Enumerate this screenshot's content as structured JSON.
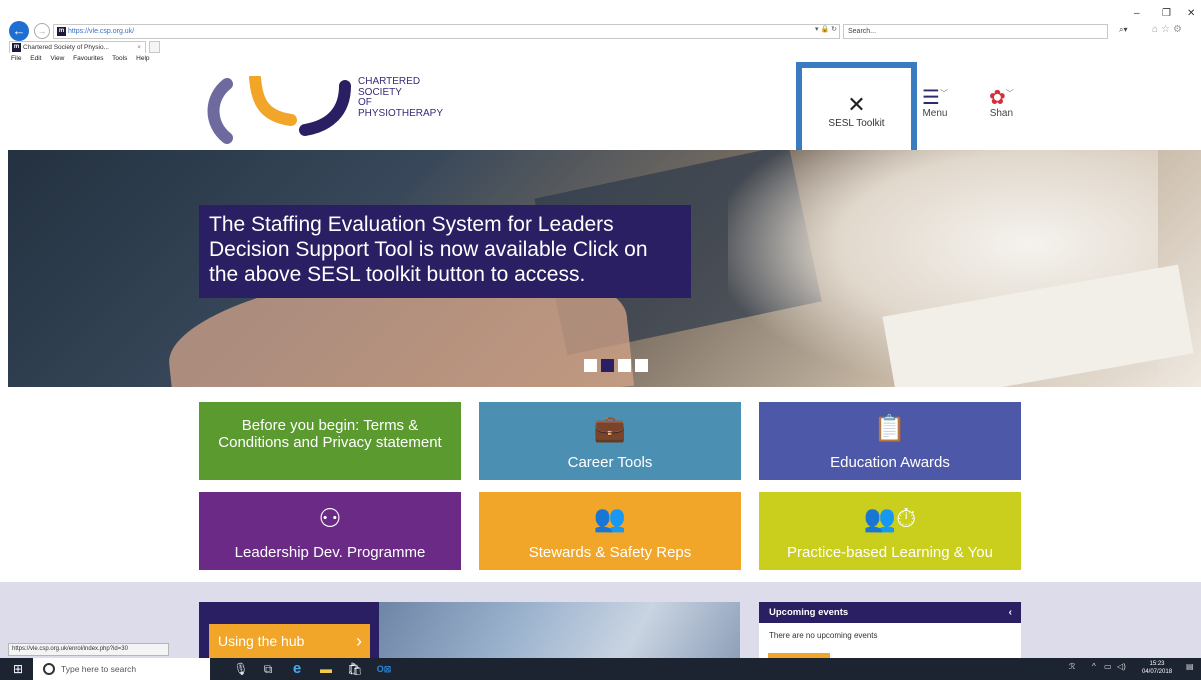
{
  "browser": {
    "address": "https://vle.csp.org.uk/",
    "search_placeholder": "Search...",
    "tab_title": "Chartered Society of Physio...",
    "tab_close": "×",
    "menu": [
      "File",
      "Edit",
      "View",
      "Favourites",
      "Tools",
      "Help"
    ],
    "status_url": "https://vle.csp.org.uk/enrol/index.php?id=30"
  },
  "site": {
    "org_name_lines": [
      "CHARTERED",
      "SOCIETY",
      "OF",
      "PHYSIOTHERAPY"
    ],
    "header": {
      "sesl_label": "SESL Toolkit",
      "menu_label": "Menu",
      "user_label": "Shan"
    },
    "hero": {
      "caption": "The Staffing Evaluation System for Leaders Decision Support Tool is now available Click on the above SESL toolkit button to access.",
      "slides": 4,
      "active_slide": 2
    },
    "tiles": [
      {
        "label": "Before you begin: Terms & Conditions and Privacy statement",
        "color": "#5b9a2f",
        "icon": ""
      },
      {
        "label": "Career Tools",
        "color": "#4b8fb3",
        "icon": "briefcase-icon"
      },
      {
        "label": "Education Awards",
        "color": "#4d59a8",
        "icon": "clipboard-icon"
      },
      {
        "label": "Leadership Dev. Programme",
        "color": "#6b2a86",
        "icon": "org-chart-icon"
      },
      {
        "label": "Stewards & Safety Reps",
        "color": "#f1a62a",
        "icon": "people-icon"
      },
      {
        "label": "Practice-based Learning & You",
        "color": "#c9cf1c",
        "icon": "clock-people-icon"
      }
    ],
    "hub_button": "Using the hub",
    "events": {
      "title": "Upcoming events",
      "empty_text": "There are no upcoming events"
    }
  },
  "taskbar": {
    "search_placeholder": "Type here to search",
    "time": "15:23",
    "date": "04/07/2018"
  }
}
